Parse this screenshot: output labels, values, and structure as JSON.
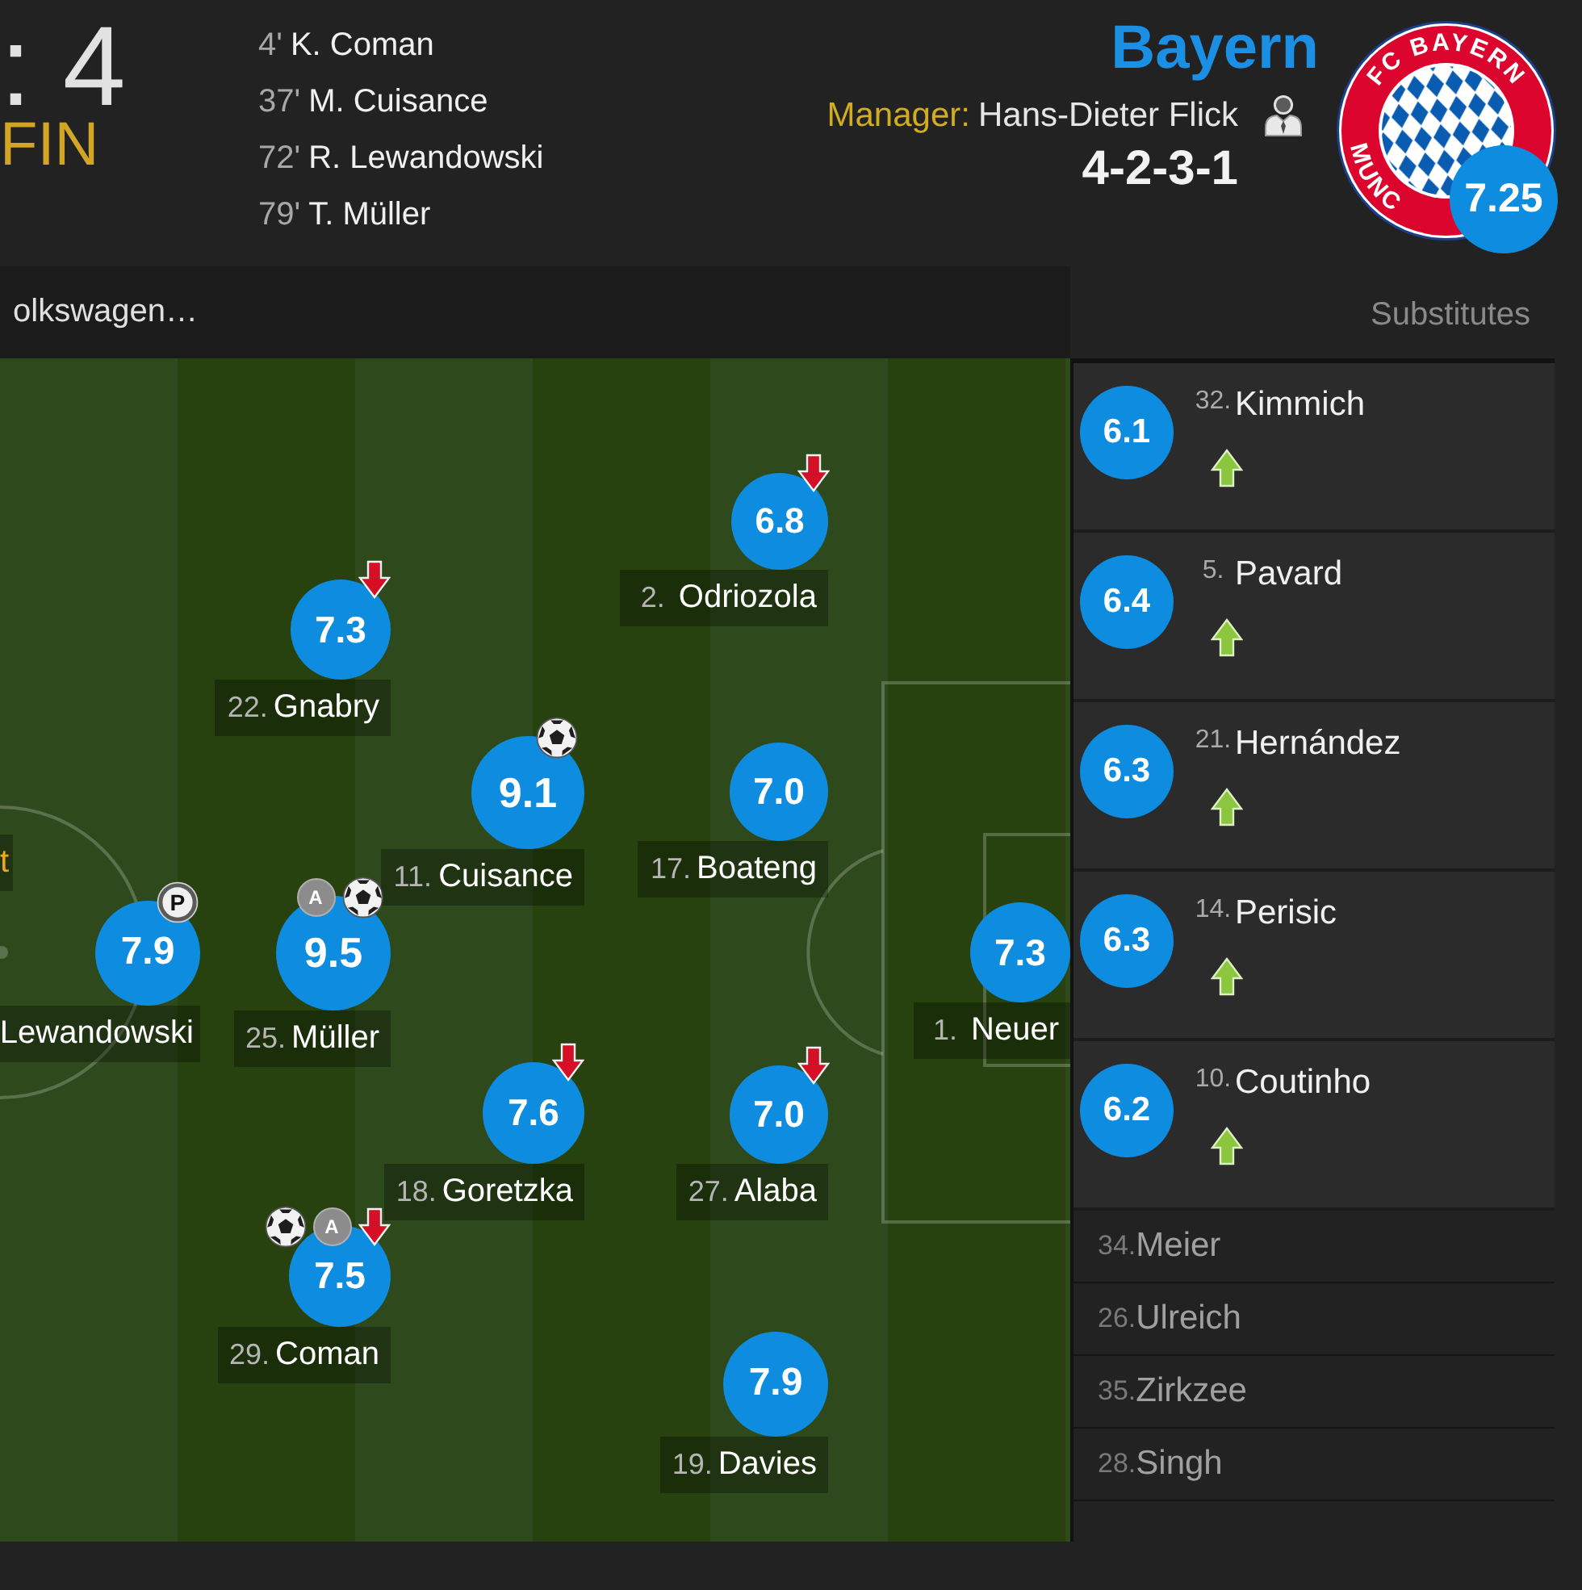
{
  "match": {
    "score": ": 4",
    "status": "FIN",
    "scorers": [
      {
        "minute": "4'",
        "name": "K. Coman"
      },
      {
        "minute": "37'",
        "name": "M. Cuisance"
      },
      {
        "minute": "72'",
        "name": "R. Lewandowski"
      },
      {
        "minute": "79'",
        "name": "T. Müller"
      }
    ]
  },
  "team": {
    "name": "Bayern",
    "manager_label": "Manager:",
    "manager": "Hans-Dieter Flick",
    "formation": "4-2-3-1",
    "crest": {
      "top_text": "FC BAYERN",
      "bottom_text": "MUNC"
    },
    "rating": "7.25"
  },
  "info_bar": {
    "text": "olkswagen…"
  },
  "substitutes_heading": "Substitutes",
  "pitch": {
    "edge_label": "t",
    "lines": [
      {
        "players": [
          {
            "name": "Lewandowski",
            "rating": "7.9",
            "events": [
              {
                "kind": "penalty_goal",
                "label": "P"
              }
            ]
          }
        ]
      },
      {
        "players": [
          {
            "number": "22.",
            "name": "Gnabry",
            "rating": "7.3",
            "events": [
              {
                "kind": "sub_off"
              }
            ]
          },
          {
            "number": "25.",
            "name": "Müller",
            "rating": "9.5",
            "events": [
              {
                "kind": "assist",
                "label": "A"
              },
              {
                "kind": "goal"
              }
            ]
          },
          {
            "number": "29.",
            "name": "Coman",
            "rating": "7.5",
            "events": [
              {
                "kind": "goal"
              },
              {
                "kind": "assist",
                "label": "A"
              },
              {
                "kind": "sub_off"
              }
            ]
          }
        ]
      },
      {
        "players": [
          {
            "number": "11.",
            "name": "Cuisance",
            "rating": "9.1",
            "events": [
              {
                "kind": "goal"
              }
            ]
          },
          {
            "number": "18.",
            "name": "Goretzka",
            "rating": "7.6",
            "events": [
              {
                "kind": "sub_off"
              }
            ]
          }
        ]
      },
      {
        "players": [
          {
            "number": "2.",
            "name": "Odriozola",
            "rating": "6.8",
            "events": [
              {
                "kind": "sub_off"
              }
            ]
          },
          {
            "number": "17.",
            "name": "Boateng",
            "rating": "7.0"
          },
          {
            "number": "27.",
            "name": "Alaba",
            "rating": "7.0",
            "events": [
              {
                "kind": "sub_off"
              }
            ]
          },
          {
            "number": "19.",
            "name": "Davies",
            "rating": "7.9"
          }
        ]
      },
      {
        "players": [
          {
            "number": "1.",
            "name": "Neuer",
            "rating": "7.3"
          }
        ]
      }
    ]
  },
  "substitutes": [
    {
      "kind": "played",
      "number": "32.",
      "name": "Kimmich",
      "rating": "6.1",
      "events": [
        {
          "kind": "sub_on"
        }
      ]
    },
    {
      "kind": "played",
      "number": "5.",
      "name": "Pavard",
      "rating": "6.4",
      "events": [
        {
          "kind": "sub_on"
        }
      ]
    },
    {
      "kind": "played",
      "number": "21.",
      "name": "Hernández",
      "rating": "6.3",
      "events": [
        {
          "kind": "sub_on"
        }
      ]
    },
    {
      "kind": "played",
      "number": "14.",
      "name": "Perisic",
      "rating": "6.3",
      "events": [
        {
          "kind": "sub_on"
        }
      ]
    },
    {
      "kind": "played",
      "number": "10.",
      "name": "Coutinho",
      "rating": "6.2",
      "events": [
        {
          "kind": "sub_on"
        }
      ]
    },
    {
      "kind": "unused",
      "number": "34.",
      "name": "Meier"
    },
    {
      "kind": "unused",
      "number": "26.",
      "name": "Ulreich"
    },
    {
      "kind": "unused",
      "number": "35.",
      "name": "Zirkzee"
    },
    {
      "kind": "unused",
      "number": "28.",
      "name": "Singh"
    }
  ]
}
